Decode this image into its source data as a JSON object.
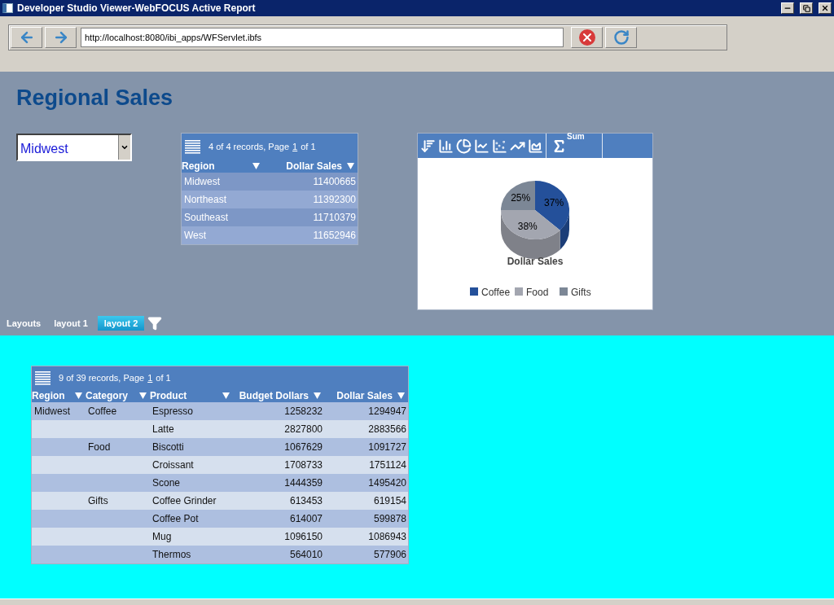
{
  "window": {
    "title": "Developer Studio Viewer-WebFOCUS Active Report"
  },
  "browser": {
    "address": "http://localhost:8080/ibi_apps/WFServlet.ibfs"
  },
  "page": {
    "title": "Regional Sales"
  },
  "filter": {
    "value": "Midwest"
  },
  "summary_table": {
    "records_text": "4 of 4 records, Page",
    "page_link": "1",
    "page_total": "of 1",
    "columns": [
      {
        "label": "Region"
      },
      {
        "label": "Dollar Sales"
      }
    ],
    "rows": [
      [
        "Midwest",
        "11400665"
      ],
      [
        "Northeast",
        "11392300"
      ],
      [
        "Southeast",
        "11710379"
      ],
      [
        "West",
        "11652946"
      ]
    ]
  },
  "chart_panel": {
    "aggregate": "Sum",
    "chart_data": {
      "type": "pie",
      "title": "Dollar Sales",
      "categories": [
        "Coffee",
        "Food",
        "Gifts"
      ],
      "values": [
        37,
        38,
        25
      ],
      "colors": [
        "#24509a",
        "#a3a6b0",
        "#7c8796"
      ],
      "value_labels": [
        "37%",
        "38%",
        "25%"
      ],
      "legend": "bottom"
    }
  },
  "layouts": {
    "label": "Layouts",
    "tabs": [
      {
        "label": "layout 1",
        "selected": false
      },
      {
        "label": "layout 2",
        "selected": true
      }
    ]
  },
  "detail_table": {
    "records_text": "9 of 39 records, Page",
    "page_link": "1",
    "page_total": "of 1",
    "columns": [
      {
        "label": "Region"
      },
      {
        "label": "Category"
      },
      {
        "label": "Product"
      },
      {
        "label": "Budget Dollars"
      },
      {
        "label": "Dollar Sales"
      }
    ],
    "rows": [
      {
        "region": "Midwest",
        "category": "Coffee",
        "product": "Espresso",
        "budget": "1258232",
        "sales": "1294947"
      },
      {
        "product": "Latte",
        "budget": "2827800",
        "sales": "2883566"
      },
      {
        "category": "Food",
        "product": "Biscotti",
        "budget": "1067629",
        "sales": "1091727"
      },
      {
        "product": "Croissant",
        "budget": "1708733",
        "sales": "1751124"
      },
      {
        "product": "Scone",
        "budget": "1444359",
        "sales": "1495420"
      },
      {
        "category": "Gifts",
        "product": "Coffee Grinder",
        "budget": "613453",
        "sales": "619154"
      },
      {
        "product": "Coffee Pot",
        "budget": "614007",
        "sales": "599878"
      },
      {
        "product": "Mug",
        "budget": "1096150",
        "sales": "1086943"
      },
      {
        "product": "Thermos",
        "budget": "564010",
        "sales": "577906"
      }
    ]
  }
}
